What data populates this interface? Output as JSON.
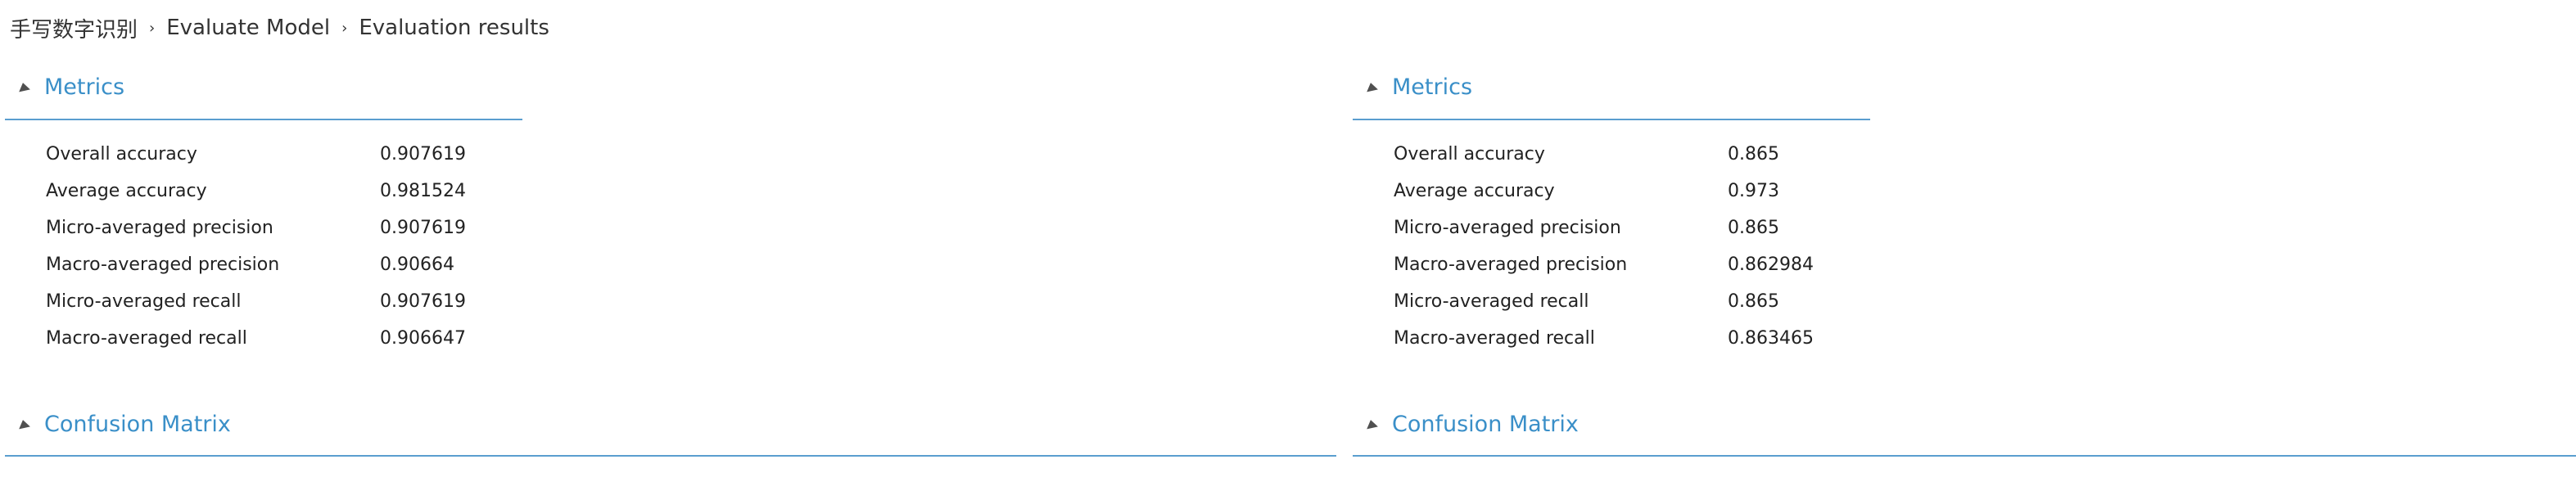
{
  "breadcrumb": {
    "items": [
      "手写数字识别",
      "Evaluate Model",
      "Evaluation results"
    ],
    "separator": "›"
  },
  "panels": [
    {
      "metrics_title": "Metrics",
      "confusion_title": "Confusion Matrix",
      "metrics": [
        {
          "name": "Overall accuracy",
          "value": "0.907619"
        },
        {
          "name": "Average accuracy",
          "value": "0.981524"
        },
        {
          "name": "Micro-averaged precision",
          "value": "0.907619"
        },
        {
          "name": "Macro-averaged precision",
          "value": "0.90664"
        },
        {
          "name": "Micro-averaged recall",
          "value": "0.907619"
        },
        {
          "name": "Macro-averaged recall",
          "value": "0.906647"
        }
      ]
    },
    {
      "metrics_title": "Metrics",
      "confusion_title": "Confusion Matrix",
      "metrics": [
        {
          "name": "Overall accuracy",
          "value": "0.865"
        },
        {
          "name": "Average accuracy",
          "value": "0.973"
        },
        {
          "name": "Micro-averaged precision",
          "value": "0.865"
        },
        {
          "name": "Macro-averaged precision",
          "value": "0.862984"
        },
        {
          "name": "Micro-averaged recall",
          "value": "0.865"
        },
        {
          "name": "Macro-averaged recall",
          "value": "0.863465"
        }
      ]
    }
  ],
  "colors": {
    "accent": "#3a8fc8",
    "rule": "#5a9ecf",
    "text": "#222222"
  }
}
